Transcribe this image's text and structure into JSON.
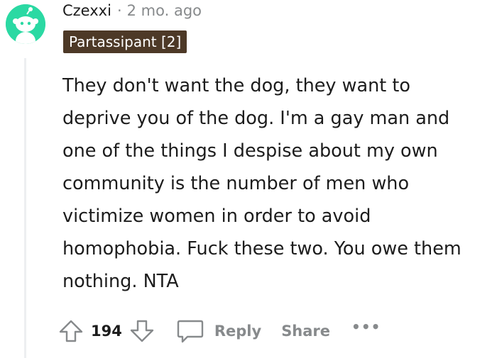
{
  "comment": {
    "author": "Czexxi",
    "separator": "·",
    "timestamp": "2 mo. ago",
    "flair": "Partassipant [2]",
    "body": "They don't want the dog, they want to deprive you of the dog. I'm a gay man and one of the things I despise about my own community is the number of men who victimize women in order to avoid homophobia. Fuck these two. You owe them nothing. NTA"
  },
  "actions": {
    "score": "194",
    "reply_label": "Reply",
    "share_label": "Share",
    "more_label": "•••"
  },
  "icons": {
    "avatar": "reddit-snoo-avatar-icon",
    "upvote": "upvote-arrow-icon",
    "downvote": "downvote-arrow-icon",
    "reply": "comment-bubble-icon",
    "more": "more-options-icon"
  },
  "colors": {
    "avatar_bg": "#2bd9a3",
    "flair_bg": "#4d3927",
    "muted_text": "#878a8c",
    "text": "#1c1c1c"
  }
}
